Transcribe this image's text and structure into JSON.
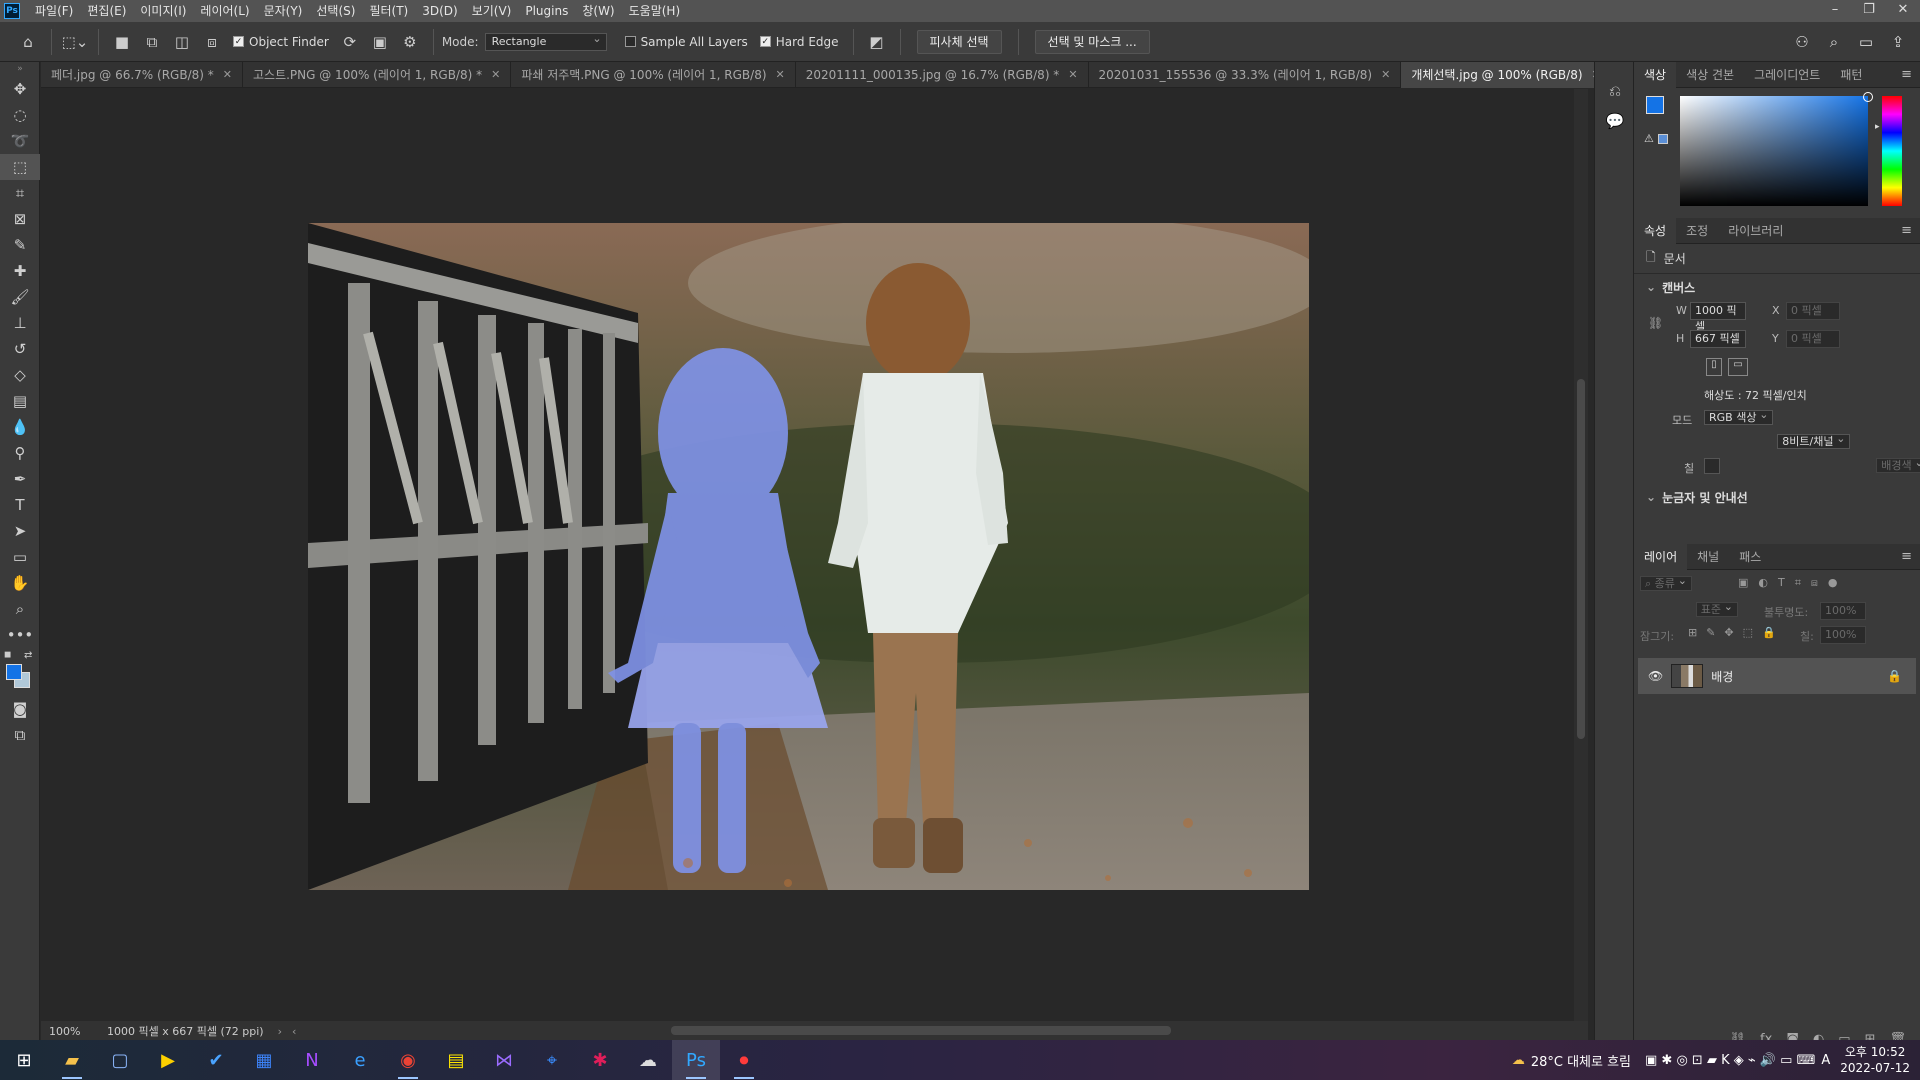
{
  "app": {
    "logo": "Ps"
  },
  "menu": [
    "파일(F)",
    "편집(E)",
    "이미지(I)",
    "레이어(L)",
    "문자(Y)",
    "선택(S)",
    "필터(T)",
    "3D(D)",
    "보기(V)",
    "Plugins",
    "창(W)",
    "도움말(H)"
  ],
  "options": {
    "object_finder": "Object Finder",
    "mode_label": "Mode:",
    "mode_value": "Rectangle",
    "sample_all_layers": "Sample All Layers",
    "hard_edge": "Hard Edge",
    "select_subject": "피사체 선택",
    "select_and_mask": "선택 및 마스크 ..."
  },
  "tabs": [
    {
      "label": "페더.jpg @ 66.7% (RGB/8) *",
      "active": false
    },
    {
      "label": "고스트.PNG @ 100% (레이어 1, RGB/8) *",
      "active": false
    },
    {
      "label": "파쇄 저주맥.PNG @ 100% (레이어 1, RGB/8)",
      "active": false
    },
    {
      "label": "20201111_000135.jpg @ 16.7% (RGB/8) *",
      "active": false
    },
    {
      "label": "20201031_155536 @ 33.3% (레이어 1, RGB/8)",
      "active": false
    },
    {
      "label": "개체선택.jpg @ 100% (RGB/8)",
      "active": true
    }
  ],
  "status": {
    "zoom": "100%",
    "doc_info": "1000 픽셀 x 667 픽셀 (72 ppi)"
  },
  "color_panel": {
    "tabs": [
      "색상",
      "색상 견본",
      "그레이디언트",
      "패턴"
    ],
    "fg": "#1473e6",
    "bg": "#b0c8d8"
  },
  "properties": {
    "tabs": [
      "속성",
      "조정",
      "라이브러리"
    ],
    "doc_label": "문서",
    "canvas_header": "캔버스",
    "w_label": "W",
    "w_value": "1000 픽셀",
    "h_label": "H",
    "h_value": "667 픽셀",
    "x_label": "X",
    "x_value": "0 픽셀",
    "y_label": "Y",
    "y_value": "0 픽셀",
    "resolution": "해상도 : 72 픽셀/인치",
    "mode_label": "모드",
    "mode_value": "RGB 색상",
    "bits_value": "8비트/채널",
    "fill_label": "칠",
    "fill_value": "배경색",
    "rulers_header": "눈금자 및 안내선"
  },
  "layers": {
    "tabs": [
      "레이어",
      "채널",
      "패스"
    ],
    "search_placeholder": "종류",
    "blend_mode": "표준",
    "opacity_label": "불투명도:",
    "opacity_value": "100%",
    "lock_label": "잠그기:",
    "fill_label": "칠:",
    "fill_value": "100%",
    "items": [
      {
        "name": "배경",
        "visible": true,
        "locked": true
      }
    ]
  },
  "taskbar": {
    "weather": "28°C 대체로 흐림",
    "time": "오후 10:52",
    "date": "2022-07-12",
    "ime": "A"
  }
}
